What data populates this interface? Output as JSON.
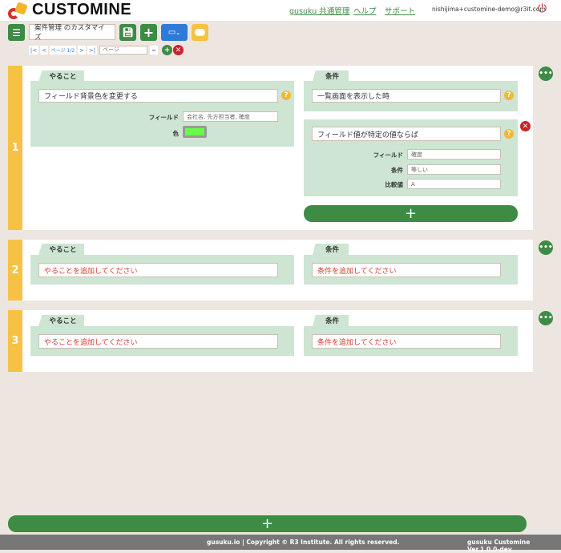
{
  "header": {
    "logo": "CUSTOMINE",
    "links": [
      "gusuku 共通管理",
      "ヘルプ",
      "サポート"
    ],
    "user_email": "nishijima+customine-demo@r3it.com"
  },
  "toolbar": {
    "title_value": "案件管理 のカスタマイズ",
    "pager_label": "ページ 1/2",
    "page_input_placeholder": "ページ"
  },
  "cards": [
    {
      "number": "1",
      "do_tab": "やること",
      "cond_tab": "条件",
      "do_action": "フィールド背景色を変更する",
      "do_fields": [
        {
          "label": "フィールド",
          "value": "会社名, 先方担当者, 確度"
        },
        {
          "label": "色",
          "color": "#66ff44"
        }
      ],
      "conditions": [
        {
          "value": "一覧画面を表示した時"
        },
        {
          "value": "フィールド値が特定の値ならば",
          "fields": [
            {
              "label": "フィールド",
              "value": "確度"
            },
            {
              "label": "条件",
              "value": "等しい"
            },
            {
              "label": "比較値",
              "value": "A"
            }
          ]
        }
      ]
    },
    {
      "number": "2",
      "do_tab": "やること",
      "cond_tab": "条件",
      "do_placeholder": "やることを追加してください",
      "cond_placeholder": "条件を追加してください"
    },
    {
      "number": "3",
      "do_tab": "やること",
      "cond_tab": "条件",
      "do_placeholder": "やることを追加してください",
      "cond_placeholder": "条件を追加してください"
    }
  ],
  "footer": {
    "copyright": "gusuku.io | Copyright © R3 Institute. All rights reserved.",
    "version": "gusuku Customine Ver.1.0.0-dev"
  },
  "colors": {
    "green": "#3d8b45",
    "panel": "#cde5d2",
    "accent": "#f7c244",
    "danger": "#c8232c",
    "background": "#ede6e0"
  }
}
